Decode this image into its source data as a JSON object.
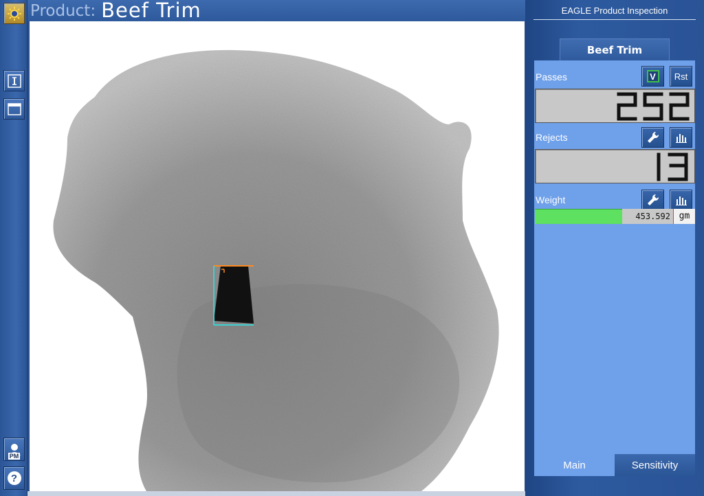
{
  "header": {
    "prefix": "Product:",
    "product_name": "Beef Trim"
  },
  "toolbar": {
    "icons": [
      "sun-status-icon",
      "info-icon",
      "window-icon",
      "pm-user-icon",
      "help-icon"
    ],
    "pm_label": "PM",
    "help_label": "?"
  },
  "panel": {
    "title": "EAGLE Product Inspection",
    "product_tab": "Beef Trim",
    "passes": {
      "label": "Passes",
      "v_button": "V",
      "reset_button": "Rst",
      "count": "252"
    },
    "rejects": {
      "label": "Rejects",
      "count": "13"
    },
    "weight": {
      "label": "Weight",
      "value": "453.592",
      "unit": "gm"
    },
    "tabs": {
      "main": "Main",
      "sensitivity": "Sensitivity"
    }
  },
  "colors": {
    "accent_blue": "#6fa0ea",
    "weight_bar_green": "#5ee060",
    "detection_box_cyan": "#3fd0d0",
    "detection_top_orange": "#ff8a1f"
  }
}
